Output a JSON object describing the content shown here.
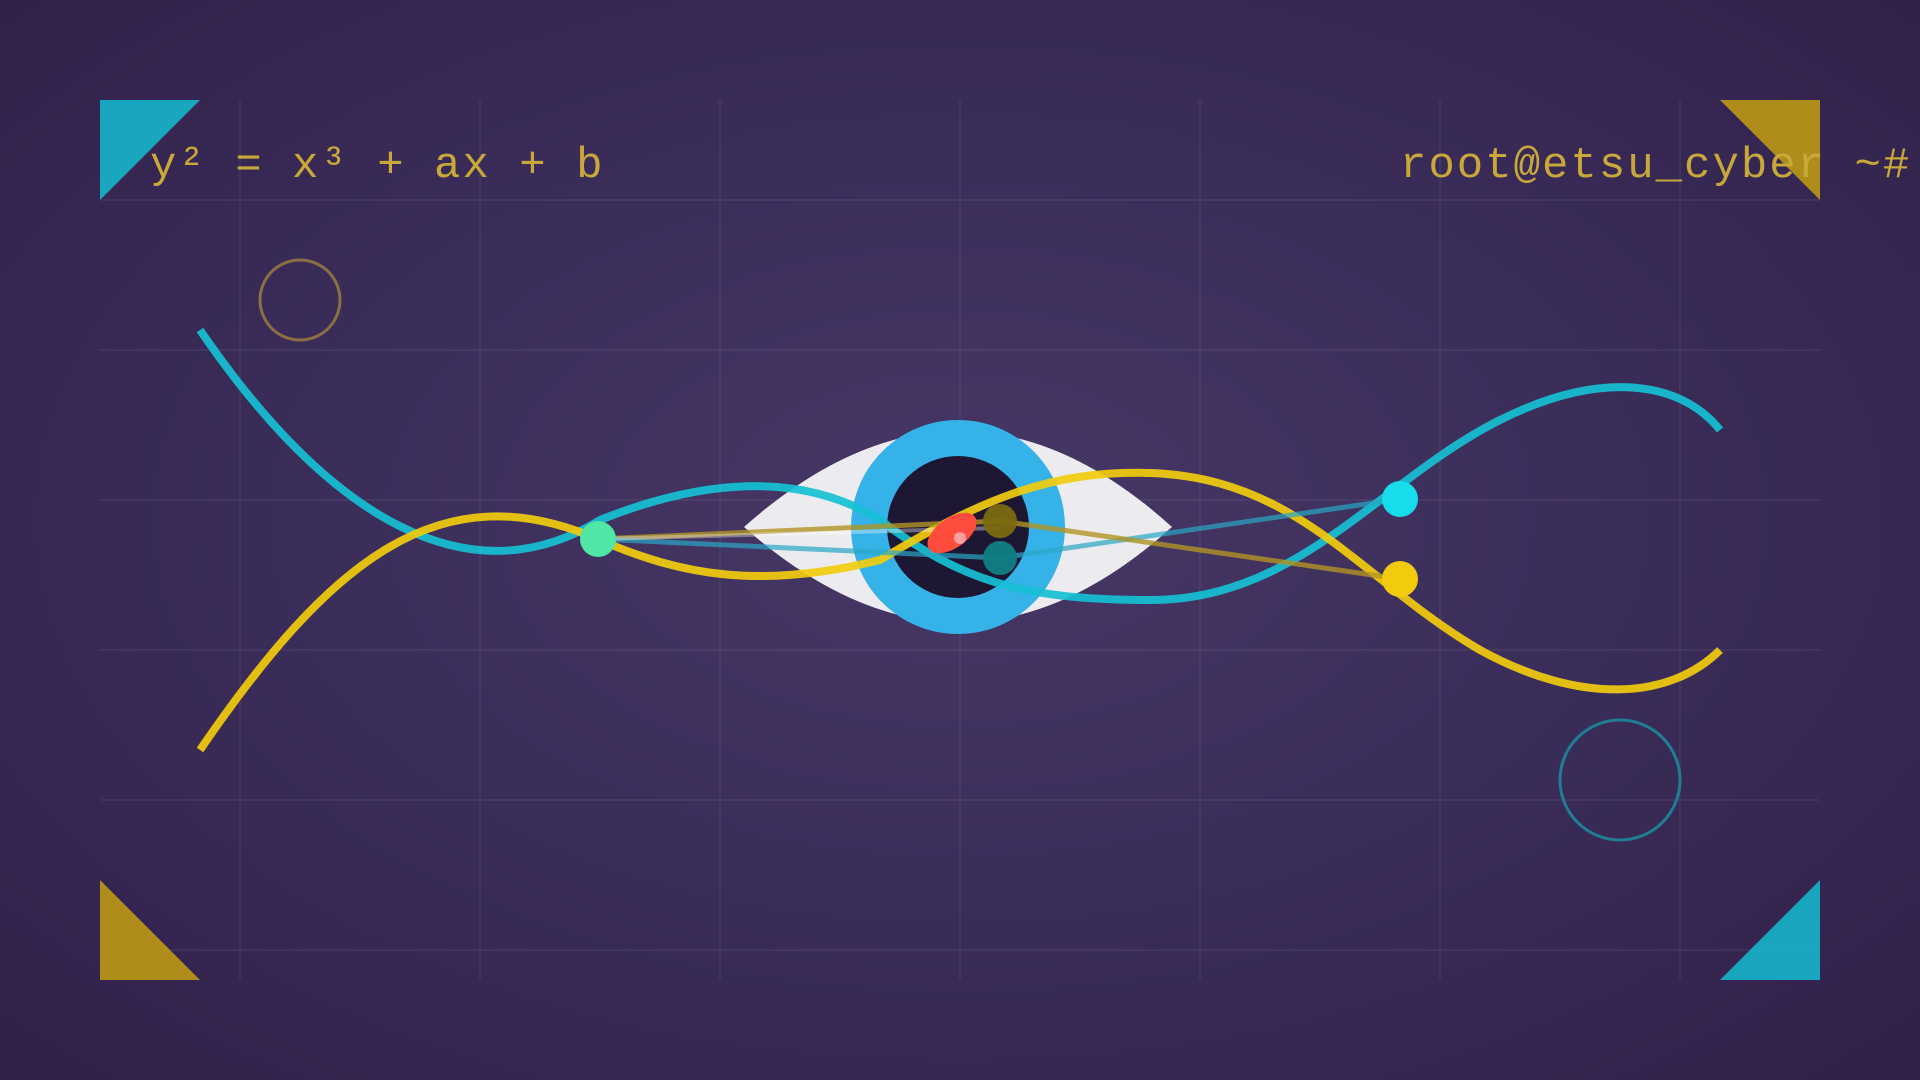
{
  "equation": "y² = x³ + ax + b",
  "prompt": "root@etsu_cyber ~#",
  "icons": {
    "eye": "eye-icon",
    "corner": "corner-triangle-icon",
    "ring": "ring-icon"
  },
  "colors": {
    "background": "#3b2c58",
    "cyan": "#16c0d4",
    "yellow": "#f2cc0c",
    "gold_dim": "#b09424",
    "eye_white": "#ececf0",
    "iris": "#35b2e8",
    "pupil": "#1e1733",
    "spark": "#ff4d3d",
    "green_point": "#4fe6a6",
    "text": "#c9a83a",
    "ring_gold": "#8a6f43",
    "ring_teal": "#1f7e94"
  }
}
